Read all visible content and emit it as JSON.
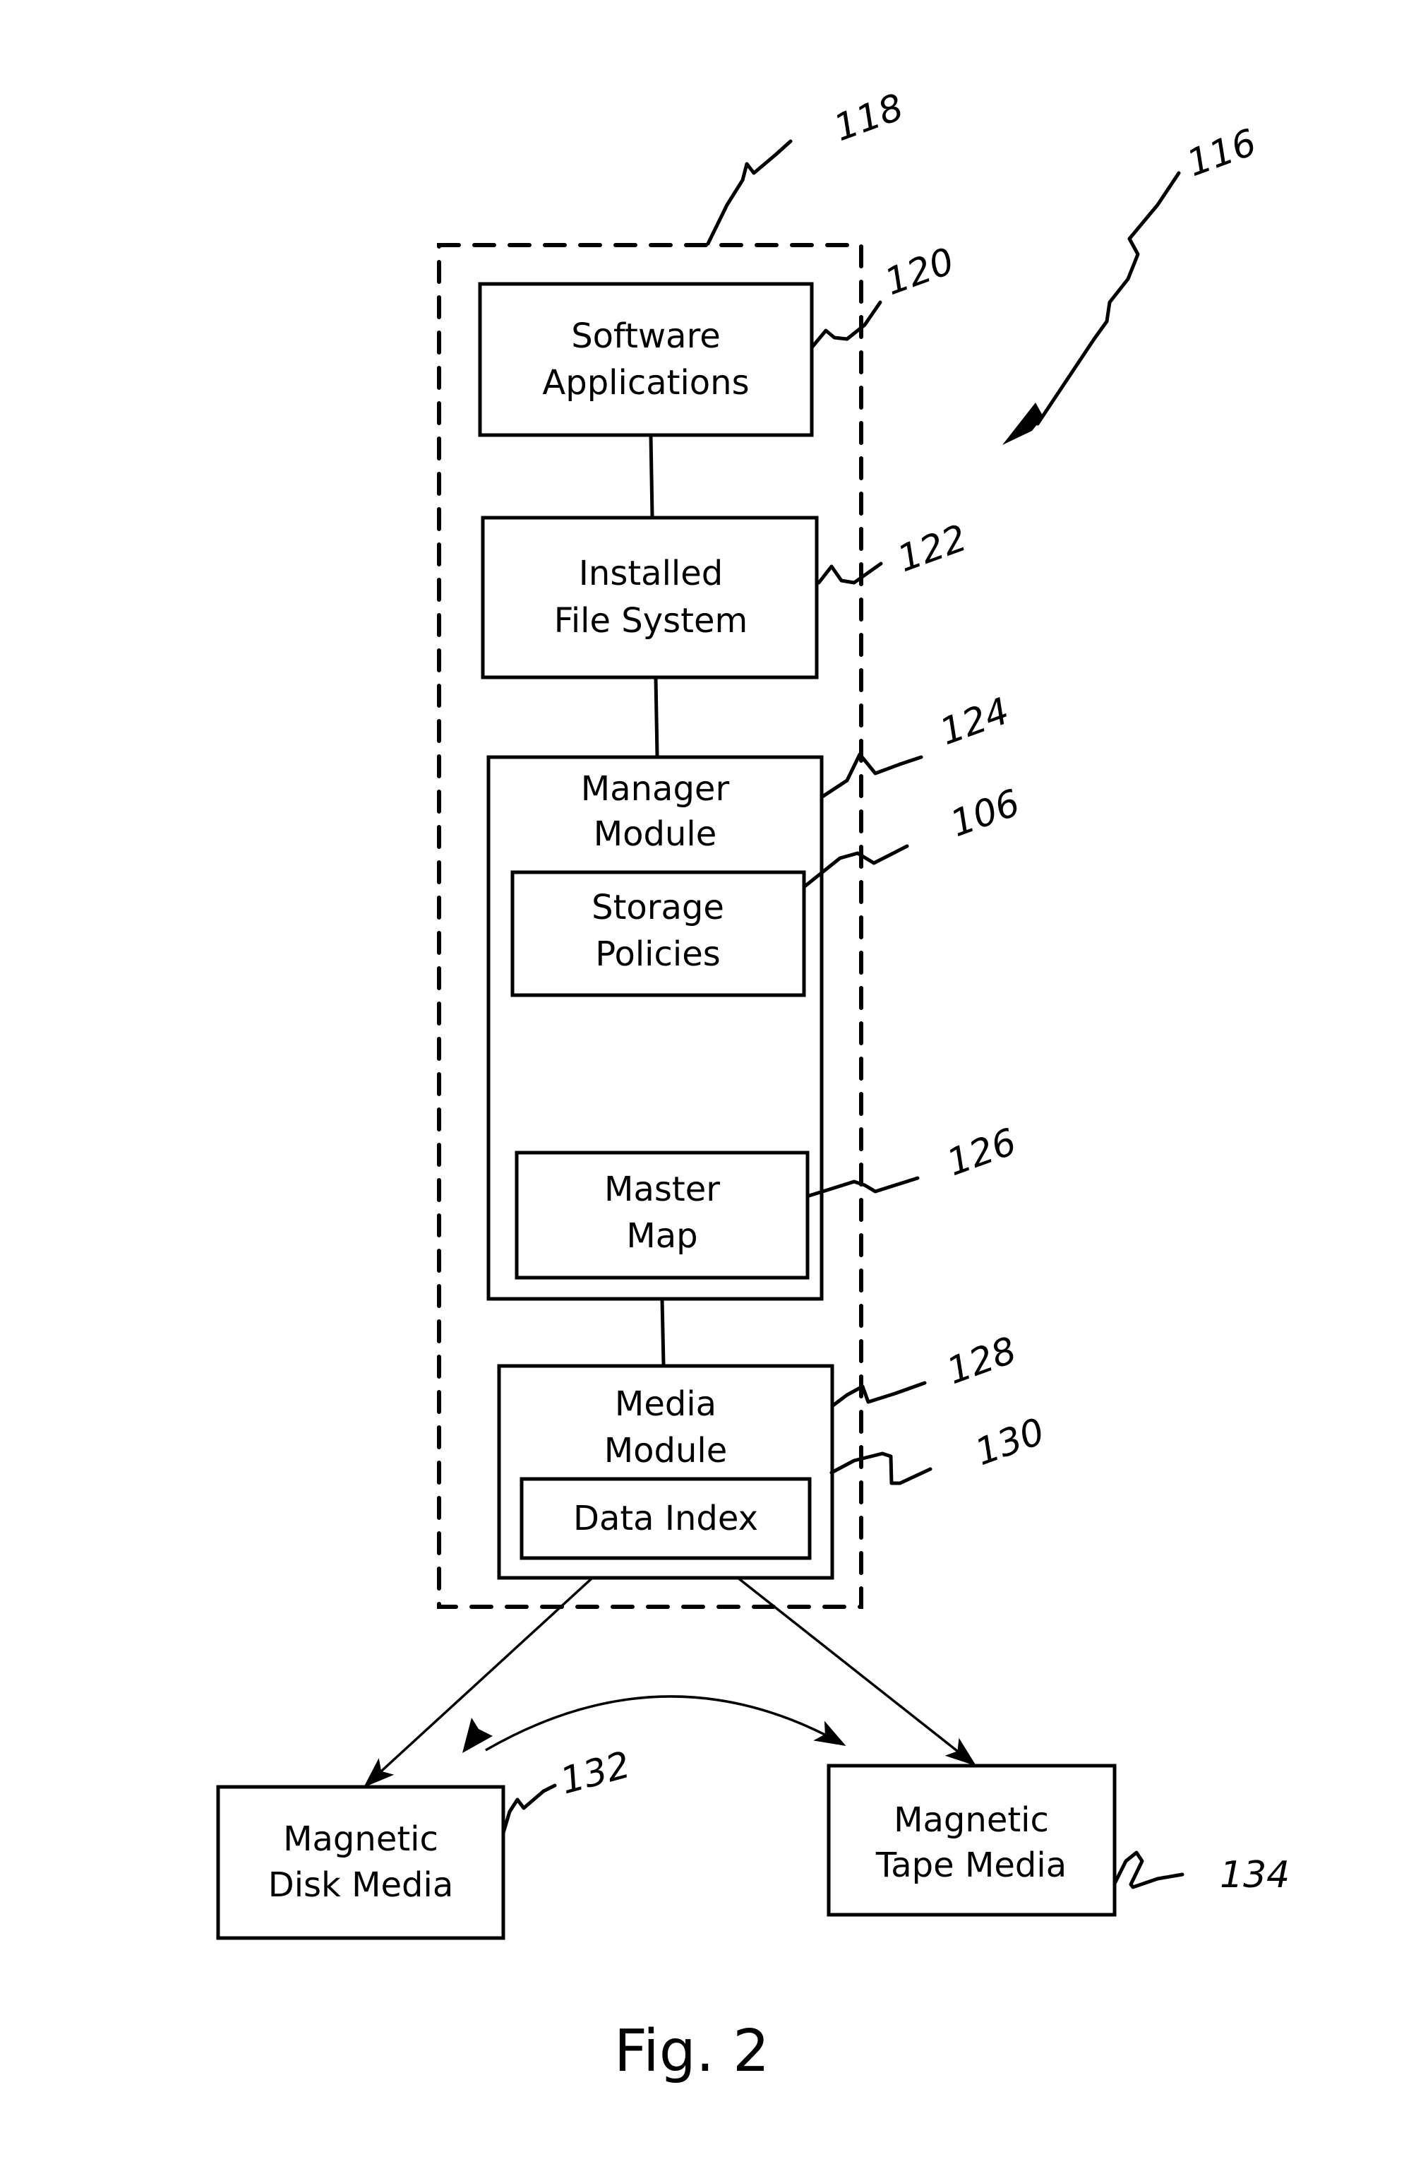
{
  "figure": {
    "caption": "Fig. 2",
    "system_ref": "116",
    "container_ref": "118"
  },
  "blocks": {
    "software_applications": {
      "lines": [
        "Software",
        "Applications"
      ],
      "ref": "120"
    },
    "installed_file_system": {
      "lines": [
        "Installed",
        "File System"
      ],
      "ref": "122"
    },
    "manager_module": {
      "lines": [
        "Manager",
        "Module"
      ],
      "ref": "124"
    },
    "storage_policies": {
      "lines": [
        "Storage",
        "Policies"
      ],
      "ref": "106"
    },
    "master_map": {
      "lines": [
        "Master",
        "Map"
      ],
      "ref": "126"
    },
    "media_module": {
      "lines": [
        "Media",
        "Module"
      ],
      "ref": "128"
    },
    "data_index": {
      "lines": [
        "Data Index"
      ],
      "ref": "130"
    },
    "magnetic_disk_media": {
      "lines": [
        "Magnetic",
        "Disk Media"
      ],
      "ref": "132"
    },
    "magnetic_tape_media": {
      "lines": [
        "Magnetic",
        "Tape Media"
      ],
      "ref": "134"
    }
  },
  "connections": [
    {
      "from": "Software Applications",
      "to": "Installed File System",
      "type": "line"
    },
    {
      "from": "Installed File System",
      "to": "Manager Module",
      "type": "line"
    },
    {
      "from": "Manager Module",
      "to": "Media Module",
      "type": "line"
    },
    {
      "from": "Media Module",
      "to": "Magnetic Disk Media",
      "type": "arrow"
    },
    {
      "from": "Media Module",
      "to": "Magnetic Tape Media",
      "type": "arrow"
    },
    {
      "from": "Magnetic Disk Media",
      "to": "Magnetic Tape Media",
      "type": "bidirectional-arrow"
    }
  ]
}
